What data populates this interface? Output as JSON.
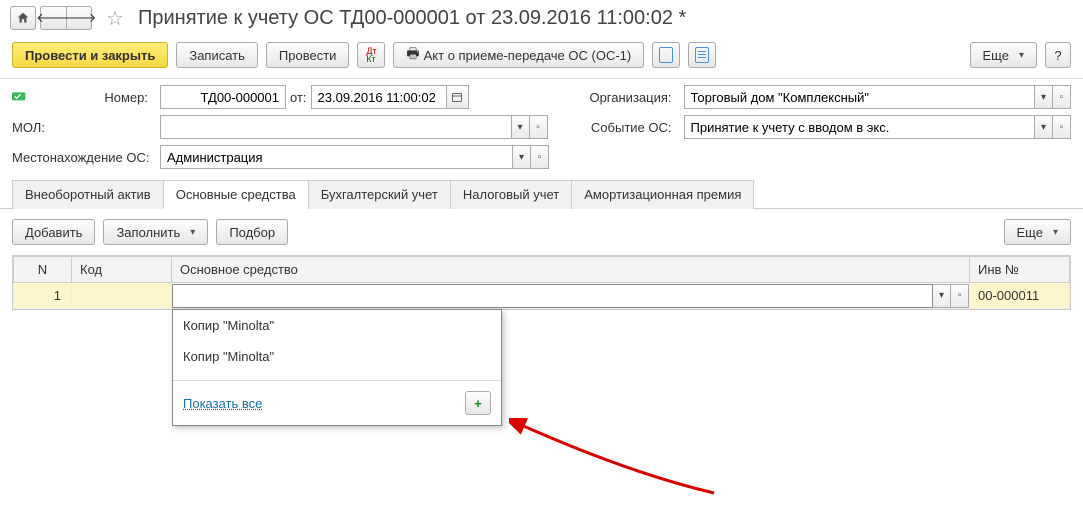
{
  "header": {
    "title": "Принятие к учету ОС ТД00-000001 от 23.09.2016 11:00:02 *"
  },
  "toolbar": {
    "post_close": "Провести и закрыть",
    "save": "Записать",
    "post": "Провести",
    "act": "Акт о приеме-передаче ОС (ОС-1)",
    "more": "Еще",
    "help": "?"
  },
  "form": {
    "number_label": "Номер:",
    "number_value": "ТД00-000001",
    "from_label": "от:",
    "date_value": "23.09.2016 11:00:02",
    "org_label": "Организация:",
    "org_value": "Торговый дом \"Комплексный\"",
    "mol_label": "МОЛ:",
    "mol_value": "",
    "event_label": "Событие ОС:",
    "event_value": "Принятие к учету с вводом в экс.",
    "location_label": "Местонахождение ОС:",
    "location_value": "Администрация"
  },
  "tabs": [
    {
      "label": "Внеоборотный актив"
    },
    {
      "label": "Основные средства"
    },
    {
      "label": "Бухгалтерский учет"
    },
    {
      "label": "Налоговый учет"
    },
    {
      "label": "Амортизационная премия"
    }
  ],
  "subbar": {
    "add": "Добавить",
    "fill": "Заполнить",
    "select": "Подбор",
    "more": "Еще"
  },
  "grid": {
    "columns": {
      "n": "N",
      "code": "Код",
      "os": "Основное средство",
      "inv": "Инв №"
    },
    "row": {
      "n": "1",
      "code": "",
      "os_value": "",
      "inv": "00-000011"
    }
  },
  "dropdown": {
    "items": [
      "Копир \"Minolta\"",
      "Копир \"Minolta\""
    ],
    "show_all": "Показать все"
  }
}
